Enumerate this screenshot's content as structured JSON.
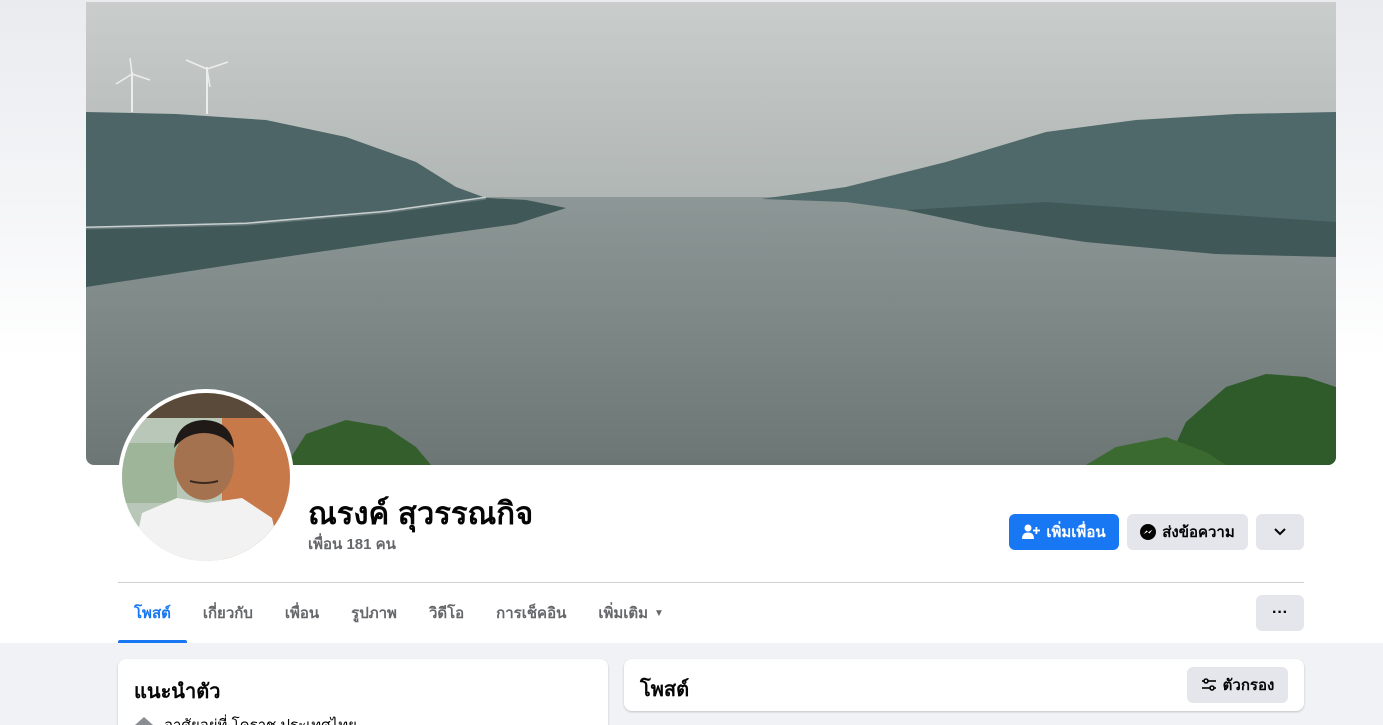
{
  "profile": {
    "name": "ณรงค์ สุวรรณกิจ",
    "friends_text": "เพื่อน 181 คน"
  },
  "actions": {
    "add_friend": "เพิ่มเพื่อน",
    "message": "ส่งข้อความ"
  },
  "tabs": [
    {
      "label": "โพสต์",
      "active": true
    },
    {
      "label": "เกี่ยวกับ",
      "active": false
    },
    {
      "label": "เพื่อน",
      "active": false
    },
    {
      "label": "รูปภาพ",
      "active": false
    },
    {
      "label": "วิดีโอ",
      "active": false
    },
    {
      "label": "การเช็คอิน",
      "active": false
    },
    {
      "label": "เพิ่มเติม",
      "active": false
    }
  ],
  "intro": {
    "title": "แนะนำตัว",
    "lives_in": "อาศัยอยู่ที่ โคราช ประเทศไทย"
  },
  "posts": {
    "title": "โพสต์",
    "filter_label": "ตัวกรอง"
  },
  "colors": {
    "accent": "#1877f2",
    "secondary_button": "#e4e6eb",
    "page_background": "#f0f2f5"
  },
  "icons": {
    "add_friend": "person-add-icon",
    "message": "messenger-icon",
    "dropdown": "chevron-down-icon",
    "more": "more-dots-icon",
    "filter": "filter-icon",
    "home": "home-icon"
  }
}
